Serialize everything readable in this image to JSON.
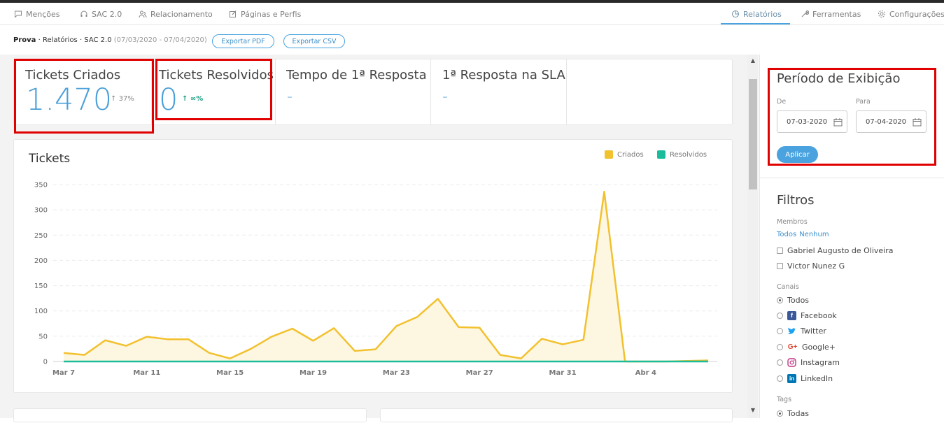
{
  "nav": {
    "left": [
      {
        "label": "Menções",
        "icon": "chat-icon"
      },
      {
        "label": "SAC 2.0",
        "icon": "headset-icon"
      },
      {
        "label": "Relacionamento",
        "icon": "users-icon"
      },
      {
        "label": "Páginas e Perfis",
        "icon": "edit-icon"
      }
    ],
    "right": [
      {
        "label": "Relatórios",
        "icon": "pie-chart-icon",
        "active": true
      },
      {
        "label": "Ferramentas",
        "icon": "wrench-icon"
      },
      {
        "label": "Configurações",
        "icon": "gear-icon"
      }
    ]
  },
  "breadcrumb": {
    "account": "Prova",
    "path": "· Relatórios · SAC 2.0",
    "range": "(07/03/2020 - 07/04/2020)"
  },
  "export": {
    "pdf": "Exportar PDF",
    "csv": "Exportar CSV"
  },
  "kpis": [
    {
      "title": "Tickets Criados",
      "value": "1.470",
      "delta": "37%"
    },
    {
      "title": "Tickets Resolvidos",
      "value": "0",
      "delta": "∞%"
    },
    {
      "title": "Tempo de 1ª Resposta",
      "value": "-"
    },
    {
      "title": "1ª Resposta na SLA",
      "value": "-"
    }
  ],
  "chart_title": "Tickets",
  "chart_data": {
    "type": "area",
    "title": "Tickets",
    "xlabel": "",
    "ylabel": "",
    "ylim": [
      0,
      350
    ],
    "yticks": [
      0,
      50,
      100,
      150,
      200,
      250,
      300,
      350
    ],
    "xticks": [
      "Mar 7",
      "Mar 11",
      "Mar 15",
      "Mar 19",
      "Mar 23",
      "Mar 27",
      "Mar 31",
      "Abr 4"
    ],
    "x": [
      "Mar 7",
      "Mar 8",
      "Mar 9",
      "Mar 10",
      "Mar 11",
      "Mar 12",
      "Mar 13",
      "Mar 14",
      "Mar 15",
      "Mar 16",
      "Mar 17",
      "Mar 18",
      "Mar 19",
      "Mar 20",
      "Mar 21",
      "Mar 22",
      "Mar 23",
      "Mar 24",
      "Mar 25",
      "Mar 26",
      "Mar 27",
      "Mar 28",
      "Mar 29",
      "Mar 30",
      "Mar 31",
      "Abr 1",
      "Abr 2",
      "Abr 3",
      "Abr 4",
      "Abr 5",
      "Abr 6",
      "Abr 7"
    ],
    "series": [
      {
        "name": "Criados",
        "color": "#f2c12e",
        "values": [
          17,
          13,
          42,
          31,
          49,
          44,
          44,
          17,
          6,
          25,
          49,
          65,
          41,
          66,
          21,
          24,
          70,
          88,
          124,
          68,
          67,
          13,
          6,
          45,
          34,
          43,
          336,
          0,
          0,
          0,
          1,
          2
        ]
      },
      {
        "name": "Resolvidos",
        "color": "#1abc9c",
        "values": [
          0,
          0,
          0,
          0,
          0,
          0,
          0,
          0,
          0,
          0,
          0,
          0,
          0,
          0,
          0,
          0,
          0,
          0,
          0,
          0,
          0,
          0,
          0,
          0,
          0,
          0,
          0,
          0,
          0,
          0,
          0,
          0
        ]
      }
    ],
    "grid": true,
    "legend": "top-right"
  },
  "sidebar": {
    "period_title": "Período de Exibição",
    "from_label": "De",
    "to_label": "Para",
    "from_value": "07-03-2020",
    "to_value": "07-04-2020",
    "apply": "Aplicar",
    "filters_title": "Filtros",
    "members_label": "Membros",
    "all_link": "Todos",
    "none_link": "Nenhum",
    "members": [
      "Gabriel Augusto de Oliveira",
      "Victor Nunez G"
    ],
    "channels_label": "Canais",
    "channels": [
      {
        "label": "Todos",
        "icon": "",
        "selected": true
      },
      {
        "label": "Facebook",
        "icon": "facebook-icon",
        "color": "#3b5998"
      },
      {
        "label": "Twitter",
        "icon": "twitter-icon",
        "color": "#1da1f2"
      },
      {
        "label": "Google+",
        "icon": "google-plus-icon",
        "color": "#dd4b39"
      },
      {
        "label": "Instagram",
        "icon": "instagram-icon",
        "color": "#c13584"
      },
      {
        "label": "LinkedIn",
        "icon": "linkedin-icon",
        "color": "#0077b5"
      }
    ],
    "tags_label": "Tags",
    "tags_all": "Todas"
  }
}
